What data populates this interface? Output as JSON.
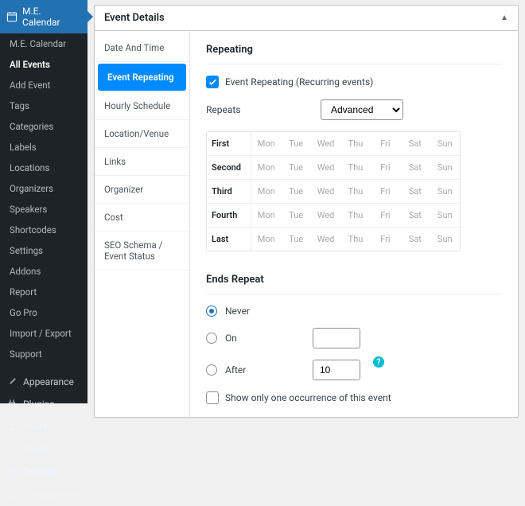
{
  "sidebar": {
    "plugin_name": "M.E. Calendar",
    "submenu": [
      {
        "label": "M.E. Calendar",
        "active": false
      },
      {
        "label": "All Events",
        "active": true
      },
      {
        "label": "Add Event",
        "active": false
      },
      {
        "label": "Tags",
        "active": false
      },
      {
        "label": "Categories",
        "active": false
      },
      {
        "label": "Labels",
        "active": false
      },
      {
        "label": "Locations",
        "active": false
      },
      {
        "label": "Organizers",
        "active": false
      },
      {
        "label": "Speakers",
        "active": false
      },
      {
        "label": "Shortcodes",
        "active": false
      },
      {
        "label": "Settings",
        "active": false
      },
      {
        "label": "Addons",
        "active": false
      },
      {
        "label": "Report",
        "active": false
      },
      {
        "label": "Go Pro",
        "active": false
      },
      {
        "label": "Import / Export",
        "active": false
      },
      {
        "label": "Support",
        "active": false
      }
    ],
    "main_items": [
      {
        "label": "Appearance",
        "icon": "brush"
      },
      {
        "label": "Plugins",
        "icon": "plug"
      },
      {
        "label": "Users",
        "icon": "user"
      },
      {
        "label": "Tools",
        "icon": "wrench"
      },
      {
        "label": "Settings",
        "icon": "gear"
      }
    ],
    "collapse_label": "Collapse menu"
  },
  "postbox": {
    "title": "Event Details",
    "tabs": [
      "Date And Time",
      "Event Repeating",
      "Hourly Schedule",
      "Location/Venue",
      "Links",
      "Organizer",
      "Cost",
      "SEO Schema / Event Status"
    ],
    "active_tab": 1
  },
  "repeating": {
    "section_title": "Repeating",
    "checkbox_label": "Event Repeating (Recurring events)",
    "checkbox_checked": true,
    "repeats_label": "Repeats",
    "repeats_value": "Advanced",
    "repeats_options": [
      "Advanced"
    ],
    "row_labels": [
      "First",
      "Second",
      "Third",
      "Fourth",
      "Last"
    ],
    "day_labels": [
      "Mon",
      "Tue",
      "Wed",
      "Thu",
      "Fri",
      "Sat",
      "Sun"
    ]
  },
  "ends": {
    "section_title": "Ends Repeat",
    "options": {
      "never": {
        "label": "Never",
        "selected": true
      },
      "on": {
        "label": "On",
        "selected": false,
        "value": ""
      },
      "after": {
        "label": "After",
        "selected": false,
        "value": "10"
      }
    },
    "show_only_one_label": "Show only one occurrence of this event",
    "show_only_one_checked": false
  }
}
